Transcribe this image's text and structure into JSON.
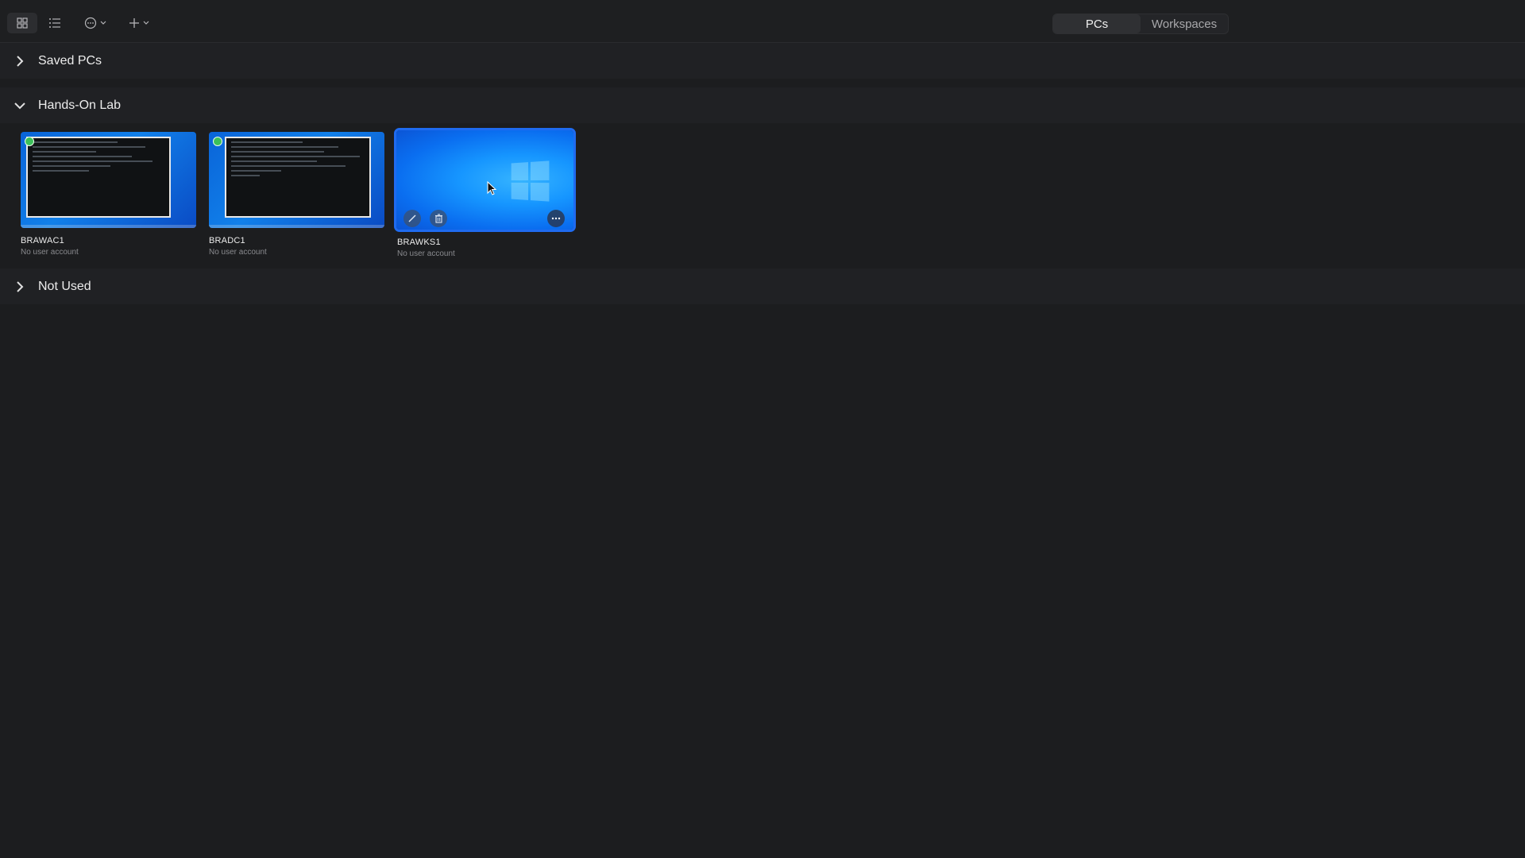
{
  "toolbar": {
    "view_grid_icon": "grid-view-icon",
    "view_list_icon": "list-view-icon",
    "more_icon": "more-options-icon",
    "add_icon": "add-icon"
  },
  "tabs": [
    {
      "label": "PCs",
      "selected": true
    },
    {
      "label": "Workspaces",
      "selected": false
    }
  ],
  "sections": {
    "saved": {
      "title": "Saved PCs",
      "expanded": false
    },
    "hands_on": {
      "title": "Hands-On Lab",
      "expanded": true
    },
    "not_used": {
      "title": "Not Used",
      "expanded": false
    }
  },
  "pcs": [
    {
      "name": "BRAWAC1",
      "account": "No user account",
      "status": "connected"
    },
    {
      "name": "BRADC1",
      "account": "No user account",
      "status": "connected"
    },
    {
      "name": "BRAWKS1",
      "account": "No user account",
      "status": "selected"
    }
  ],
  "colors": {
    "background": "#1c1d1f",
    "accent": "#1f6bf0",
    "status_green": "#3cc05a"
  }
}
